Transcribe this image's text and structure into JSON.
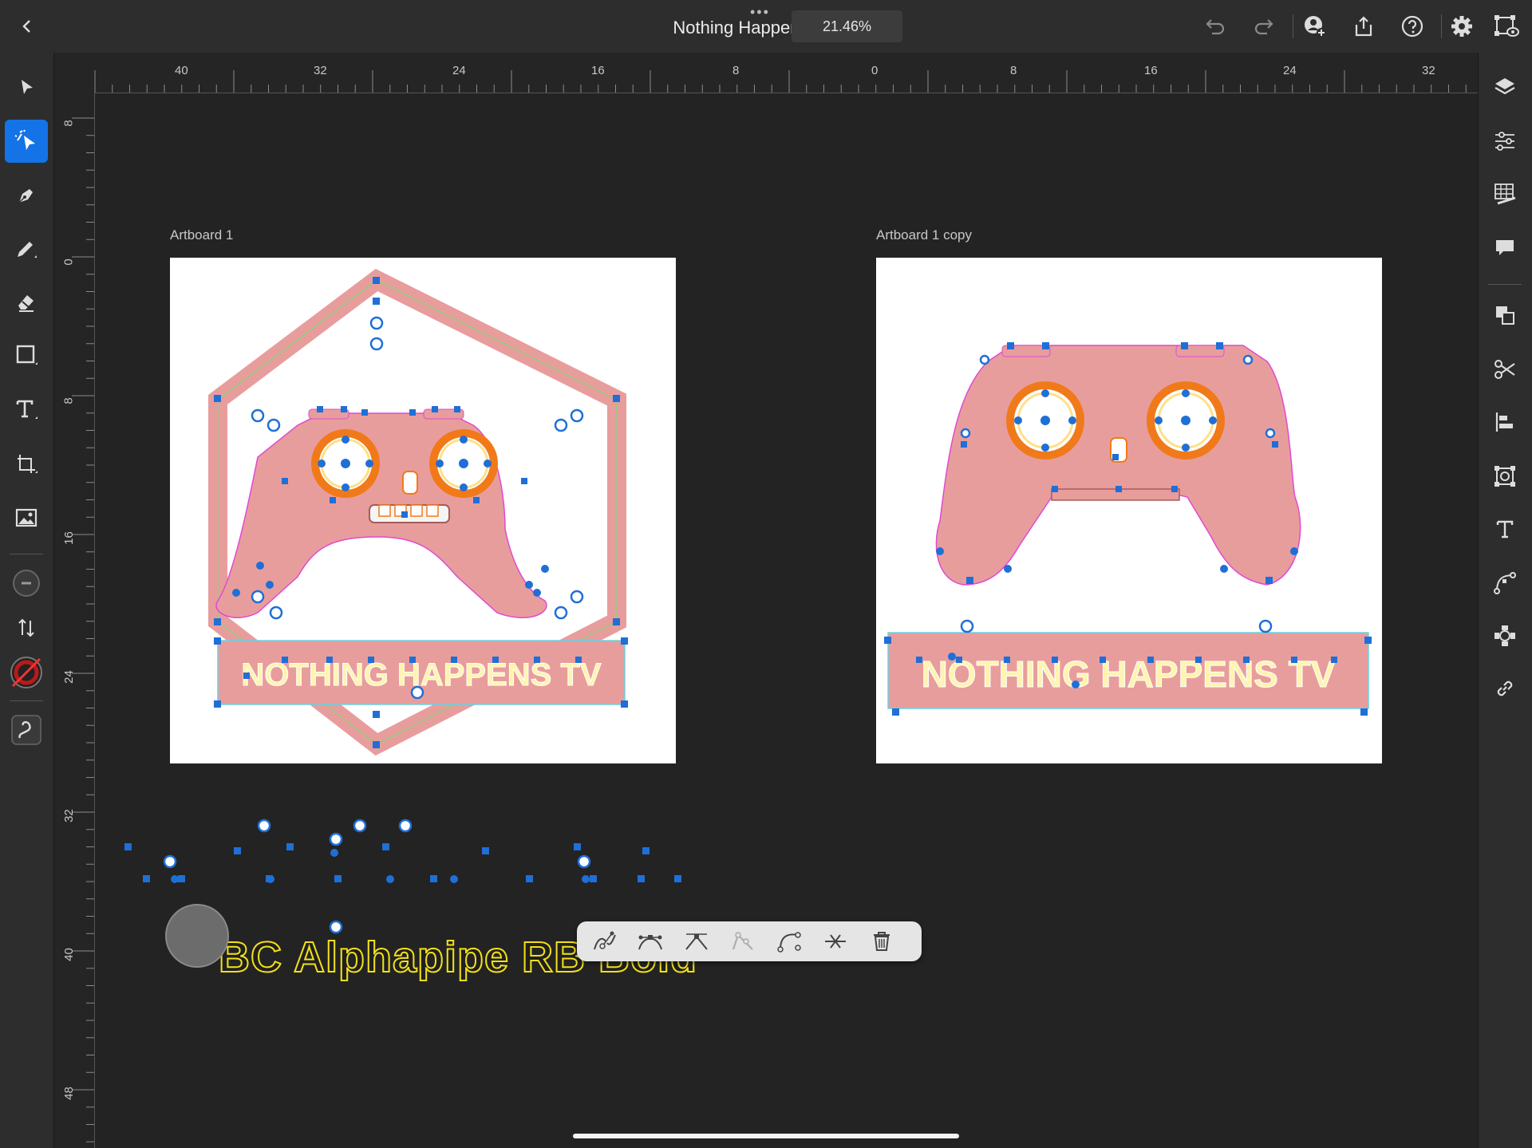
{
  "header": {
    "document_title": "Nothing Happens*",
    "zoom": "21.46%"
  },
  "toolbar_left": {
    "tools": [
      "select-tool",
      "direct-select-tool",
      "pen-tool",
      "pencil-tool",
      "eraser-tool",
      "shape-tool",
      "text-tool",
      "transform-tool",
      "image-tool",
      "layer-minus-tool",
      "swap-tool",
      "fill-stroke-tool",
      "smooth-tool"
    ]
  },
  "rulers": {
    "top_labels": [
      "40",
      "32",
      "24",
      "16",
      "8",
      "0",
      "8",
      "16",
      "24",
      "32"
    ],
    "left_labels": [
      "8",
      "0",
      "8",
      "16",
      "24",
      "32",
      "40",
      "48"
    ]
  },
  "artboards": [
    {
      "name": "Artboard 1",
      "banner_text": "NOTHING HAPPENS TV"
    },
    {
      "name": "Artboard 1 copy",
      "banner_text": "NOTHING HAPPENS TV"
    }
  ],
  "canvas_text": "BC Alphapipe RB Bold",
  "colors": {
    "accent": "#1473e6",
    "shape_pink": "#e89d9d",
    "banner_text_yellow": "#fff4b0",
    "font_outline_yellow": "#f2e01a",
    "anchor_blue": "#1f6fd6"
  },
  "node_toolbar": {
    "actions": [
      "break-path",
      "smooth-point",
      "corner-point",
      "asymmetric-point",
      "convert-curve",
      "join-points",
      "delete-point"
    ]
  }
}
